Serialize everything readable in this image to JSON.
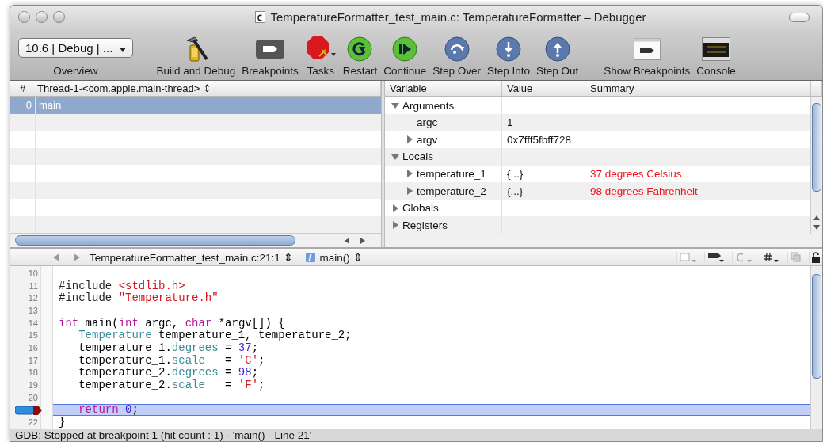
{
  "window": {
    "title": "TemperatureFormatter_test_main.c: TemperatureFormatter – Debugger"
  },
  "toolbar": {
    "overview": {
      "value": "10.6 | Debug | ...",
      "label": "Overview"
    },
    "items": [
      {
        "kind": "build",
        "label": "Build and Debug"
      },
      {
        "kind": "breakpoints",
        "label": "Breakpoints"
      },
      {
        "kind": "tasks",
        "label": "Tasks"
      },
      {
        "kind": "restart",
        "label": "Restart"
      },
      {
        "kind": "continue",
        "label": "Continue"
      },
      {
        "kind": "step-over",
        "label": "Step Over"
      },
      {
        "kind": "step-into",
        "label": "Step Into"
      },
      {
        "kind": "step-out",
        "label": "Step Out"
      },
      {
        "kind": "show-breakpoints",
        "label": "Show Breakpoints"
      },
      {
        "kind": "console",
        "label": "Console"
      }
    ]
  },
  "threads": {
    "columns": [
      "#",
      "Thread-1-<com.apple.main-thread> ⇕"
    ],
    "rows": [
      {
        "index": "0",
        "name": "main",
        "selected": true
      }
    ]
  },
  "variables": {
    "columns": [
      "Variable",
      "Value",
      "Summary"
    ],
    "items": [
      {
        "name": "Arguments",
        "kind": "node",
        "expanded": true,
        "children": [
          {
            "name": "argc",
            "value": "1",
            "kind": "leaf"
          },
          {
            "name": "argv",
            "value": "0x7fff5fbff728",
            "kind": "node",
            "expanded": false
          }
        ]
      },
      {
        "name": "Locals",
        "kind": "node",
        "expanded": true,
        "children": [
          {
            "name": "temperature_1",
            "value": "{...}",
            "summary": "37 degrees Celsius",
            "kind": "node",
            "expanded": false,
            "changed": true
          },
          {
            "name": "temperature_2",
            "value": "{...}",
            "summary": "98 degrees Fahrenheit",
            "kind": "node",
            "expanded": false,
            "changed": true
          }
        ]
      },
      {
        "name": "Globals",
        "kind": "node",
        "expanded": false
      },
      {
        "name": "Registers",
        "kind": "node",
        "expanded": false
      }
    ]
  },
  "editor": {
    "file": "TemperatureFormatter_test_main.c:21:1 ⇕",
    "function": "main() ⇕",
    "lines": [
      {
        "number": "10",
        "current": false,
        "breakpoint": false
      },
      {
        "number": "11",
        "current": false,
        "breakpoint": false,
        "tokens": [
          {
            "kind": "preproc",
            "text": "#include "
          },
          {
            "kind": "string",
            "text": "<stdlib.h>"
          }
        ]
      },
      {
        "number": "12",
        "current": false,
        "breakpoint": false,
        "tokens": [
          {
            "kind": "preproc",
            "text": "#include "
          },
          {
            "kind": "string",
            "text": "\"Temperature.h\""
          }
        ]
      },
      {
        "number": "13",
        "current": false,
        "breakpoint": false
      },
      {
        "number": "14",
        "current": false,
        "breakpoint": false,
        "tokens": [
          {
            "kind": "keyword",
            "text": "int"
          },
          {
            "kind": "plain",
            "text": " main("
          },
          {
            "kind": "keyword",
            "text": "int"
          },
          {
            "kind": "plain",
            "text": " argc, "
          },
          {
            "kind": "keyword",
            "text": "char"
          },
          {
            "kind": "plain",
            "text": " *argv[]) {"
          }
        ]
      },
      {
        "number": "15",
        "current": false,
        "breakpoint": false,
        "tokens": [
          {
            "kind": "type",
            "text": "   Temperature"
          },
          {
            "kind": "plain",
            "text": " temperature_1, temperature_2;"
          }
        ]
      },
      {
        "number": "16",
        "current": false,
        "breakpoint": false,
        "tokens": [
          {
            "kind": "plain",
            "text": "   temperature_1."
          },
          {
            "kind": "field",
            "text": "degrees"
          },
          {
            "kind": "plain",
            "text": " = "
          },
          {
            "kind": "number",
            "text": "37"
          },
          {
            "kind": "plain",
            "text": ";"
          }
        ]
      },
      {
        "number": "17",
        "current": false,
        "breakpoint": false,
        "tokens": [
          {
            "kind": "plain",
            "text": "   temperature_1."
          },
          {
            "kind": "field",
            "text": "scale"
          },
          {
            "kind": "plain",
            "text": "   = "
          },
          {
            "kind": "string",
            "text": "'C'"
          },
          {
            "kind": "plain",
            "text": ";"
          }
        ]
      },
      {
        "number": "18",
        "current": false,
        "breakpoint": false,
        "tokens": [
          {
            "kind": "plain",
            "text": "   temperature_2."
          },
          {
            "kind": "field",
            "text": "degrees"
          },
          {
            "kind": "plain",
            "text": " = "
          },
          {
            "kind": "number",
            "text": "98"
          },
          {
            "kind": "plain",
            "text": ";"
          }
        ]
      },
      {
        "number": "19",
        "current": false,
        "breakpoint": false,
        "tokens": [
          {
            "kind": "plain",
            "text": "   temperature_2."
          },
          {
            "kind": "field",
            "text": "scale"
          },
          {
            "kind": "plain",
            "text": "   = "
          },
          {
            "kind": "string",
            "text": "'F'"
          },
          {
            "kind": "plain",
            "text": ";"
          }
        ]
      },
      {
        "number": "20",
        "current": false,
        "breakpoint": false
      },
      {
        "current": true,
        "breakpoint": true,
        "tokens": [
          {
            "kind": "keyword",
            "text": "   return"
          },
          {
            "kind": "number",
            "text": " 0"
          },
          {
            "kind": "plain",
            "text": ";"
          }
        ]
      },
      {
        "number": "22",
        "current": false,
        "breakpoint": false,
        "tokens": [
          {
            "kind": "plain",
            "text": "}"
          }
        ]
      }
    ]
  },
  "status_bar": {
    "text": "GDB: Stopped at breakpoint 1 (hit count : 1) - 'main() - Line 21'"
  }
}
